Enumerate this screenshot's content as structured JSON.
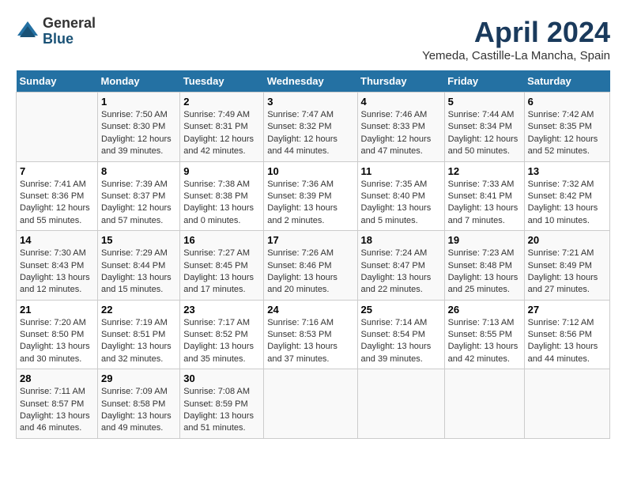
{
  "logo": {
    "general": "General",
    "blue": "Blue"
  },
  "title": "April 2024",
  "subtitle": "Yemeda, Castille-La Mancha, Spain",
  "days": [
    "Sunday",
    "Monday",
    "Tuesday",
    "Wednesday",
    "Thursday",
    "Friday",
    "Saturday"
  ],
  "weeks": [
    [
      {
        "num": "",
        "sunrise": "",
        "sunset": "",
        "daylight": ""
      },
      {
        "num": "1",
        "sunrise": "Sunrise: 7:50 AM",
        "sunset": "Sunset: 8:30 PM",
        "daylight": "Daylight: 12 hours and 39 minutes."
      },
      {
        "num": "2",
        "sunrise": "Sunrise: 7:49 AM",
        "sunset": "Sunset: 8:31 PM",
        "daylight": "Daylight: 12 hours and 42 minutes."
      },
      {
        "num": "3",
        "sunrise": "Sunrise: 7:47 AM",
        "sunset": "Sunset: 8:32 PM",
        "daylight": "Daylight: 12 hours and 44 minutes."
      },
      {
        "num": "4",
        "sunrise": "Sunrise: 7:46 AM",
        "sunset": "Sunset: 8:33 PM",
        "daylight": "Daylight: 12 hours and 47 minutes."
      },
      {
        "num": "5",
        "sunrise": "Sunrise: 7:44 AM",
        "sunset": "Sunset: 8:34 PM",
        "daylight": "Daylight: 12 hours and 50 minutes."
      },
      {
        "num": "6",
        "sunrise": "Sunrise: 7:42 AM",
        "sunset": "Sunset: 8:35 PM",
        "daylight": "Daylight: 12 hours and 52 minutes."
      }
    ],
    [
      {
        "num": "7",
        "sunrise": "Sunrise: 7:41 AM",
        "sunset": "Sunset: 8:36 PM",
        "daylight": "Daylight: 12 hours and 55 minutes."
      },
      {
        "num": "8",
        "sunrise": "Sunrise: 7:39 AM",
        "sunset": "Sunset: 8:37 PM",
        "daylight": "Daylight: 12 hours and 57 minutes."
      },
      {
        "num": "9",
        "sunrise": "Sunrise: 7:38 AM",
        "sunset": "Sunset: 8:38 PM",
        "daylight": "Daylight: 13 hours and 0 minutes."
      },
      {
        "num": "10",
        "sunrise": "Sunrise: 7:36 AM",
        "sunset": "Sunset: 8:39 PM",
        "daylight": "Daylight: 13 hours and 2 minutes."
      },
      {
        "num": "11",
        "sunrise": "Sunrise: 7:35 AM",
        "sunset": "Sunset: 8:40 PM",
        "daylight": "Daylight: 13 hours and 5 minutes."
      },
      {
        "num": "12",
        "sunrise": "Sunrise: 7:33 AM",
        "sunset": "Sunset: 8:41 PM",
        "daylight": "Daylight: 13 hours and 7 minutes."
      },
      {
        "num": "13",
        "sunrise": "Sunrise: 7:32 AM",
        "sunset": "Sunset: 8:42 PM",
        "daylight": "Daylight: 13 hours and 10 minutes."
      }
    ],
    [
      {
        "num": "14",
        "sunrise": "Sunrise: 7:30 AM",
        "sunset": "Sunset: 8:43 PM",
        "daylight": "Daylight: 13 hours and 12 minutes."
      },
      {
        "num": "15",
        "sunrise": "Sunrise: 7:29 AM",
        "sunset": "Sunset: 8:44 PM",
        "daylight": "Daylight: 13 hours and 15 minutes."
      },
      {
        "num": "16",
        "sunrise": "Sunrise: 7:27 AM",
        "sunset": "Sunset: 8:45 PM",
        "daylight": "Daylight: 13 hours and 17 minutes."
      },
      {
        "num": "17",
        "sunrise": "Sunrise: 7:26 AM",
        "sunset": "Sunset: 8:46 PM",
        "daylight": "Daylight: 13 hours and 20 minutes."
      },
      {
        "num": "18",
        "sunrise": "Sunrise: 7:24 AM",
        "sunset": "Sunset: 8:47 PM",
        "daylight": "Daylight: 13 hours and 22 minutes."
      },
      {
        "num": "19",
        "sunrise": "Sunrise: 7:23 AM",
        "sunset": "Sunset: 8:48 PM",
        "daylight": "Daylight: 13 hours and 25 minutes."
      },
      {
        "num": "20",
        "sunrise": "Sunrise: 7:21 AM",
        "sunset": "Sunset: 8:49 PM",
        "daylight": "Daylight: 13 hours and 27 minutes."
      }
    ],
    [
      {
        "num": "21",
        "sunrise": "Sunrise: 7:20 AM",
        "sunset": "Sunset: 8:50 PM",
        "daylight": "Daylight: 13 hours and 30 minutes."
      },
      {
        "num": "22",
        "sunrise": "Sunrise: 7:19 AM",
        "sunset": "Sunset: 8:51 PM",
        "daylight": "Daylight: 13 hours and 32 minutes."
      },
      {
        "num": "23",
        "sunrise": "Sunrise: 7:17 AM",
        "sunset": "Sunset: 8:52 PM",
        "daylight": "Daylight: 13 hours and 35 minutes."
      },
      {
        "num": "24",
        "sunrise": "Sunrise: 7:16 AM",
        "sunset": "Sunset: 8:53 PM",
        "daylight": "Daylight: 13 hours and 37 minutes."
      },
      {
        "num": "25",
        "sunrise": "Sunrise: 7:14 AM",
        "sunset": "Sunset: 8:54 PM",
        "daylight": "Daylight: 13 hours and 39 minutes."
      },
      {
        "num": "26",
        "sunrise": "Sunrise: 7:13 AM",
        "sunset": "Sunset: 8:55 PM",
        "daylight": "Daylight: 13 hours and 42 minutes."
      },
      {
        "num": "27",
        "sunrise": "Sunrise: 7:12 AM",
        "sunset": "Sunset: 8:56 PM",
        "daylight": "Daylight: 13 hours and 44 minutes."
      }
    ],
    [
      {
        "num": "28",
        "sunrise": "Sunrise: 7:11 AM",
        "sunset": "Sunset: 8:57 PM",
        "daylight": "Daylight: 13 hours and 46 minutes."
      },
      {
        "num": "29",
        "sunrise": "Sunrise: 7:09 AM",
        "sunset": "Sunset: 8:58 PM",
        "daylight": "Daylight: 13 hours and 49 minutes."
      },
      {
        "num": "30",
        "sunrise": "Sunrise: 7:08 AM",
        "sunset": "Sunset: 8:59 PM",
        "daylight": "Daylight: 13 hours and 51 minutes."
      },
      {
        "num": "",
        "sunrise": "",
        "sunset": "",
        "daylight": ""
      },
      {
        "num": "",
        "sunrise": "",
        "sunset": "",
        "daylight": ""
      },
      {
        "num": "",
        "sunrise": "",
        "sunset": "",
        "daylight": ""
      },
      {
        "num": "",
        "sunrise": "",
        "sunset": "",
        "daylight": ""
      }
    ]
  ]
}
